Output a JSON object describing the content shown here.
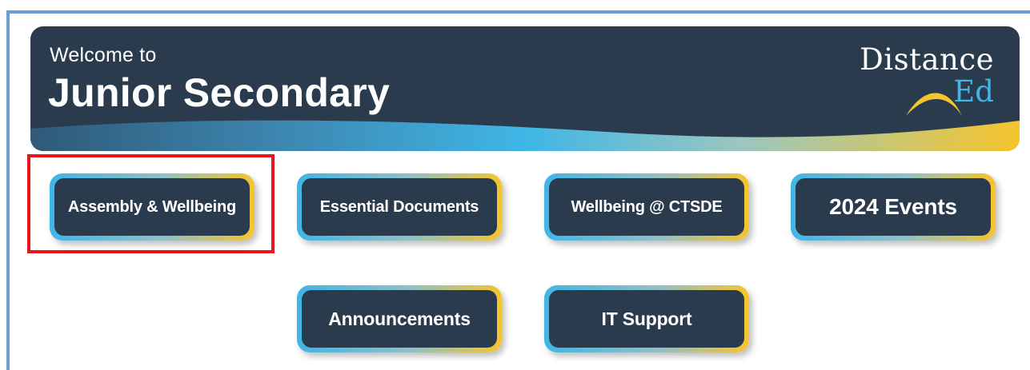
{
  "banner": {
    "welcome": "Welcome to",
    "title": "Junior Secondary",
    "logo": {
      "line1": "Distance",
      "line2": "Ed",
      "icon": "sunrise-arc-icon"
    }
  },
  "tiles": [
    {
      "label": "Assembly & Wellbeing"
    },
    {
      "label": "Essential Documents"
    },
    {
      "label": "Wellbeing @ CTSDE"
    },
    {
      "label": "2024 Events"
    },
    {
      "label": "Announcements"
    },
    {
      "label": "IT Support"
    }
  ],
  "colors": {
    "navy": "#2b3b4e",
    "accent_blue": "#3fb6e6",
    "accent_yellow": "#f5c52c",
    "highlight_red": "#e8141b",
    "frame_blue": "#6a9fd4"
  }
}
